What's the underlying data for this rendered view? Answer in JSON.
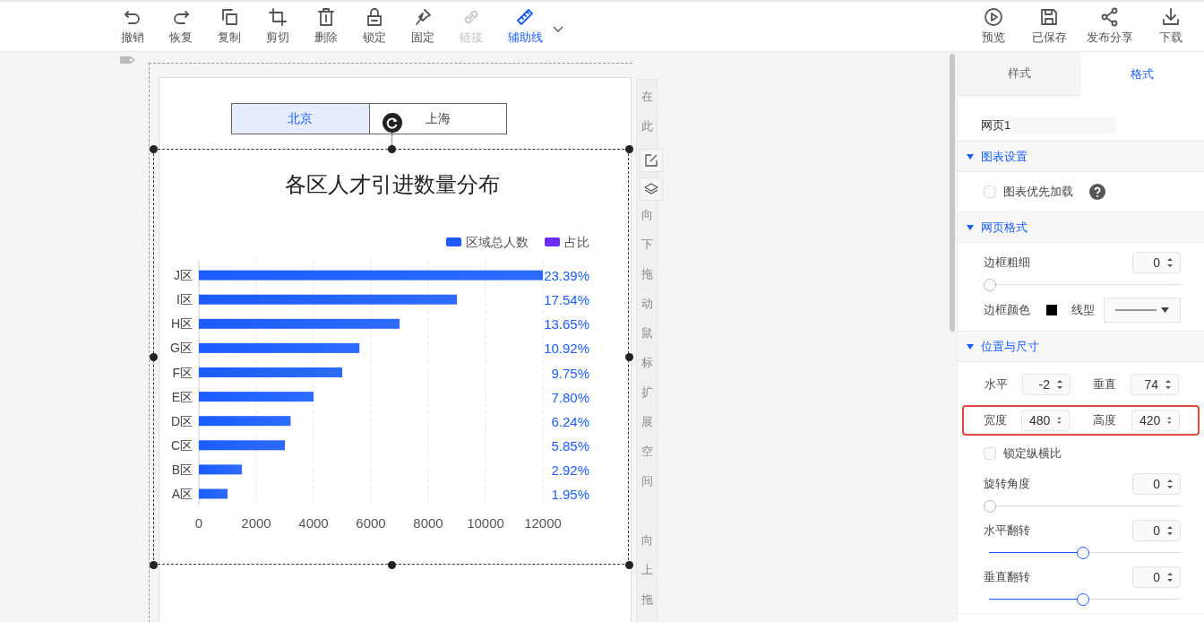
{
  "toolbar": {
    "left": [
      {
        "label": "撤销",
        "disabled": false,
        "selected": false
      },
      {
        "label": "恢复",
        "disabled": false,
        "selected": false
      },
      {
        "label": "复制",
        "disabled": false,
        "selected": false
      },
      {
        "label": "剪切",
        "disabled": false,
        "selected": false
      },
      {
        "label": "删除",
        "disabled": false,
        "selected": false
      },
      {
        "label": "锁定",
        "disabled": false,
        "selected": false
      },
      {
        "label": "固定",
        "disabled": false,
        "selected": false
      },
      {
        "label": "链接",
        "disabled": true,
        "selected": false
      },
      {
        "label": "辅助线",
        "disabled": false,
        "selected": true
      }
    ],
    "right": [
      {
        "label": "预览"
      },
      {
        "label": "已保存"
      },
      {
        "label": "发布分享"
      },
      {
        "label": "下载"
      }
    ]
  },
  "canvas": {
    "tabs": [
      {
        "label": "北京",
        "selected": true
      },
      {
        "label": "上海",
        "selected": false
      }
    ],
    "side_strip": [
      "在此",
      "向下拖动鼠标扩展空间",
      "向上拖"
    ],
    "chart": {
      "chart_data": {
        "type": "bar",
        "orientation": "horizontal",
        "title": "各区人才引进数量分布",
        "categories": [
          "J区",
          "I区",
          "H区",
          "G区",
          "F区",
          "E区",
          "D区",
          "C区",
          "B区",
          "A区"
        ],
        "series": [
          {
            "name": "区域总人数",
            "color": "#1a5cff",
            "values": [
              12000,
              9000,
              7000,
              5600,
              5000,
              4000,
              3200,
              3000,
              1500,
              1000
            ]
          }
        ],
        "xlim": [
          0,
          12000
        ],
        "xticks": [
          0,
          2000,
          4000,
          6000,
          8000,
          10000,
          12000
        ],
        "grid": true,
        "value_labels": [
          "23.39%",
          "17.54%",
          "13.65%",
          "10.92%",
          "9.75%",
          "7.80%",
          "6.24%",
          "5.85%",
          "2.92%",
          "1.95%"
        ]
      },
      "extra_legend": {
        "label": "占比",
        "color": "#6a2cf5"
      }
    }
  },
  "panel": {
    "tabs": [
      {
        "label": "样式",
        "selected": false
      },
      {
        "label": "格式",
        "selected": true
      }
    ],
    "name": "网页1",
    "sections": [
      {
        "title": "图表设置",
        "expanded": true,
        "rows": [
          {
            "kind": "checkbox",
            "label": "图表优先加载",
            "checked": false,
            "help": true
          }
        ]
      },
      {
        "title": "网页格式",
        "expanded": true,
        "rows": [
          {
            "kind": "number_slider",
            "label": "边框粗细",
            "value": "0",
            "level": 0
          },
          {
            "kind": "color_line",
            "label": "边框颜色",
            "color": "#000000",
            "line_label": "线型"
          }
        ]
      },
      {
        "title": "位置与尺寸",
        "expanded": true,
        "rows": [
          {
            "kind": "pair",
            "highlighted": false,
            "fields": [
              {
                "label": "水平",
                "value": "-2"
              },
              {
                "label": "垂直",
                "value": "74"
              }
            ]
          },
          {
            "kind": "pair",
            "highlighted": true,
            "fields": [
              {
                "label": "宽度",
                "value": "480"
              },
              {
                "label": "高度",
                "value": "420"
              }
            ]
          },
          {
            "kind": "checkbox",
            "label": "锁定纵横比",
            "checked": false,
            "help": false
          },
          {
            "kind": "number_slider",
            "label": "旋转角度",
            "value": "0",
            "level": 0
          },
          {
            "kind": "number_slider",
            "label": "水平翻转",
            "value": "0",
            "level": 0.5
          },
          {
            "kind": "number_slider",
            "label": "垂直翻转",
            "value": "0",
            "level": 0.5
          }
        ]
      }
    ]
  }
}
